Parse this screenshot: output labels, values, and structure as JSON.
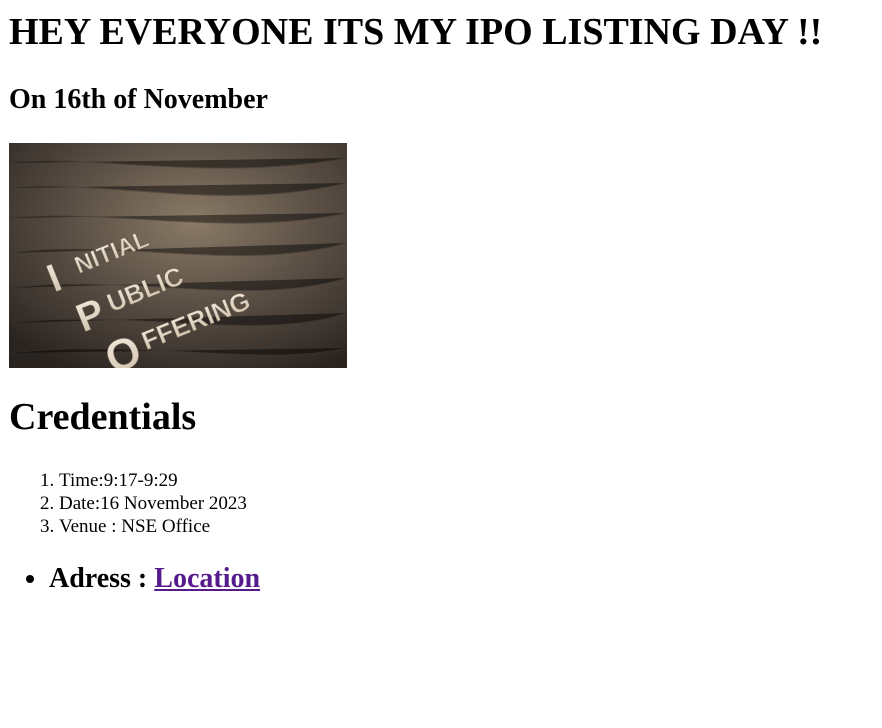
{
  "header": {
    "title": "HEY EVERYONE ITS MY IPO LISTING DAY !!",
    "subtitle": "On 16th of November"
  },
  "hero_image": {
    "alt": "",
    "words": [
      "I",
      "NITIAL",
      "P",
      "UBLIC",
      "O",
      "FFERING"
    ]
  },
  "credentials": {
    "heading": "Credentials",
    "items": [
      "Time:9:17-9:29",
      "Date:16 November 2023",
      "Venue : NSE Office"
    ]
  },
  "address": {
    "label": "Adress : ",
    "link_text": "Location"
  },
  "colors": {
    "link_visited": "#551a8b",
    "text": "#000000",
    "background": "#ffffff"
  }
}
